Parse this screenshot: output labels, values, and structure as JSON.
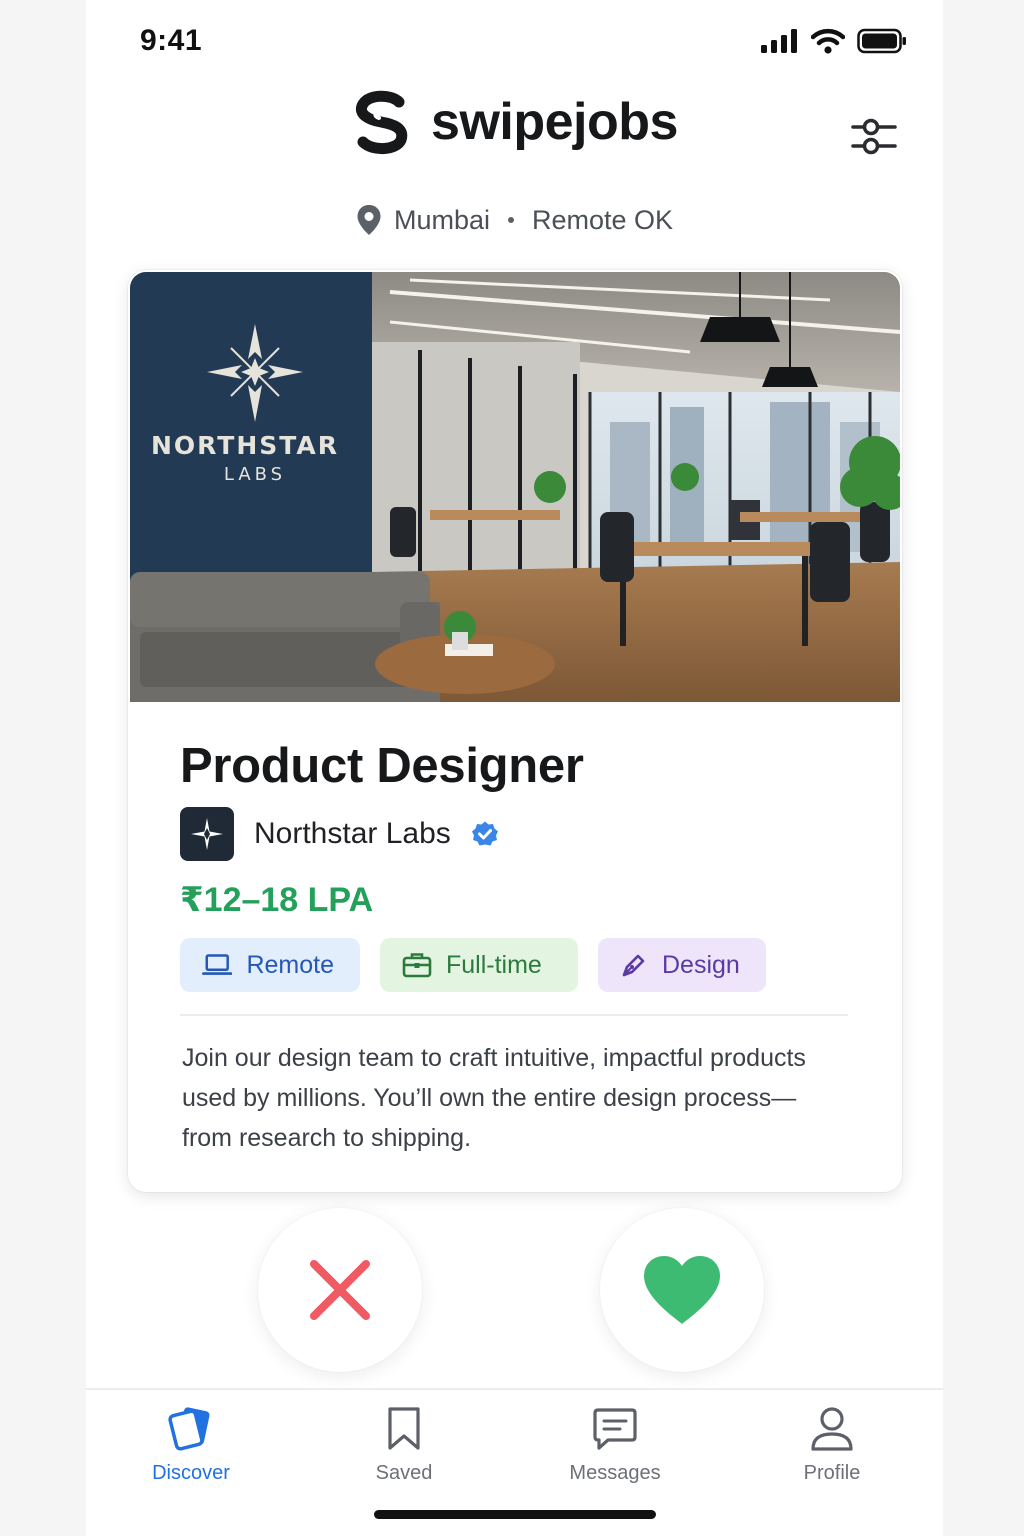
{
  "status_bar": {
    "time": "9:41"
  },
  "header": {
    "brand": "swipejobs",
    "location": "Mumbai",
    "location_extra": "Remote OK"
  },
  "card": {
    "image_sign_line1": "NORTHSTAR",
    "image_sign_line2": "LABS",
    "title": "Product Designer",
    "company": "Northstar Labs",
    "salary": "₹12–18 LPA",
    "tags": [
      {
        "label": "Remote",
        "icon": "laptop-icon"
      },
      {
        "label": "Full-time",
        "icon": "briefcase-icon"
      },
      {
        "label": "Design",
        "icon": "pen-icon"
      }
    ],
    "description": "Join our design team to craft intuitive, impactful products used by millions. You’ll own the entire design process—from research to shipping."
  },
  "nav": {
    "items": [
      {
        "label": "Discover",
        "icon": "cards-icon",
        "active": true
      },
      {
        "label": "Saved",
        "icon": "bookmark-icon",
        "active": false
      },
      {
        "label": "Messages",
        "icon": "message-icon",
        "active": false
      },
      {
        "label": "Profile",
        "icon": "user-icon",
        "active": false
      }
    ]
  },
  "colors": {
    "accent": "#2271e0",
    "salary": "#23a05a",
    "reject": "#ef5a63",
    "like": "#3dbb73"
  }
}
